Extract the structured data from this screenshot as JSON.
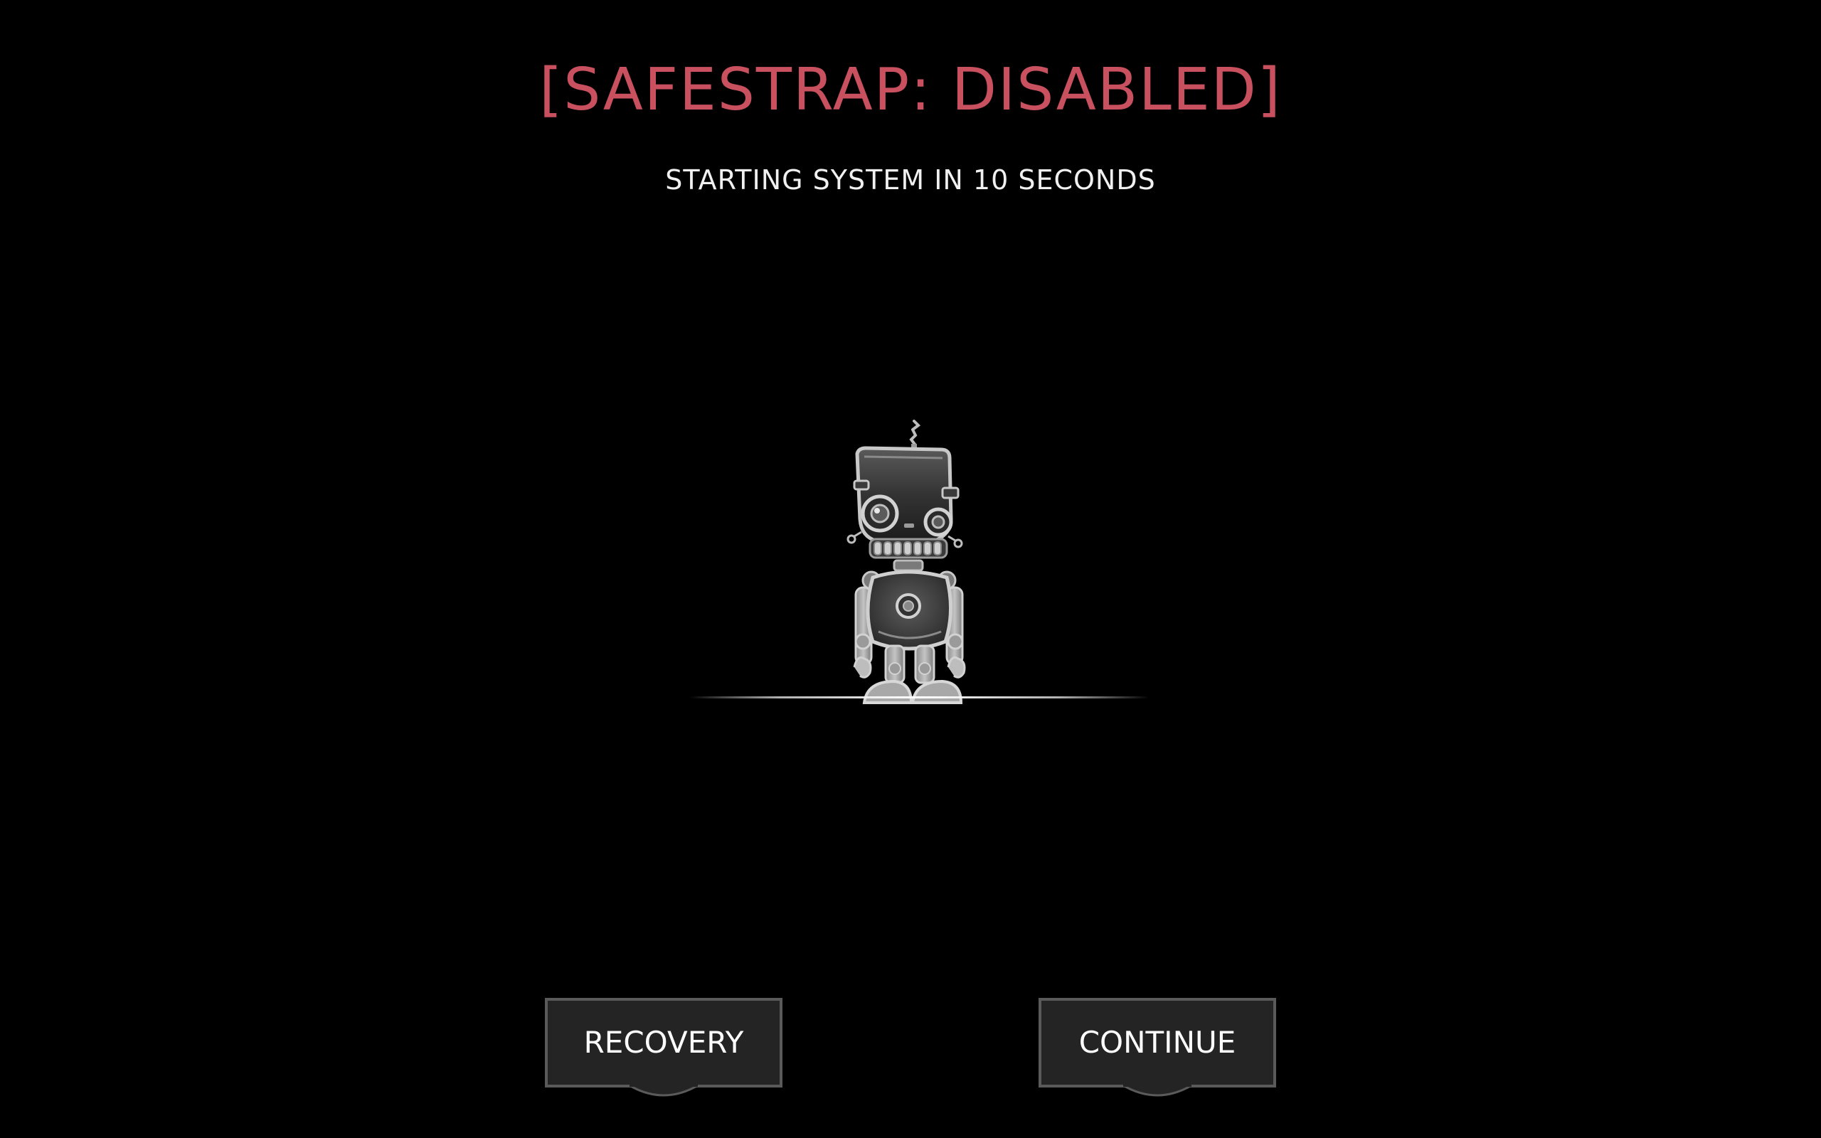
{
  "header": {
    "title": "[SAFESTRAP: DISABLED]",
    "status": "STARTING SYSTEM IN 10 SECONDS"
  },
  "illustration": {
    "icon": "robot-icon"
  },
  "buttons": {
    "recovery_label": "RECOVERY",
    "continue_label": "CONTINUE"
  },
  "colors": {
    "background": "#000000",
    "title": "#c9505e",
    "text": "#ffffff",
    "button_fill": "#242424",
    "button_border": "#5a5a5a"
  }
}
